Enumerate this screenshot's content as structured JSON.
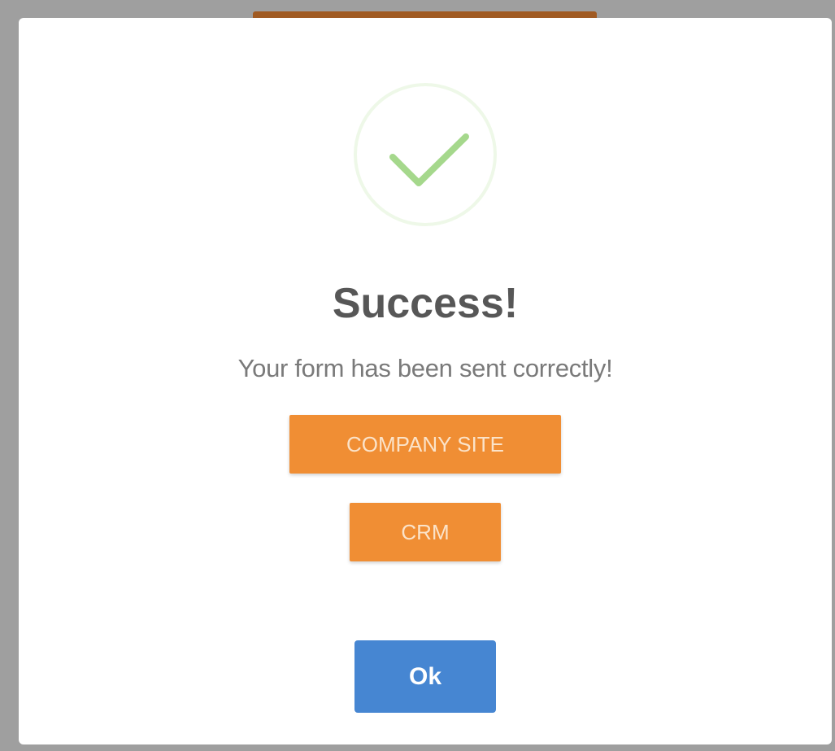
{
  "dialog": {
    "title": "Success!",
    "message": "Your form has been sent correctly!",
    "icon": "checkmark-icon",
    "buttons": {
      "company_site_label": "COMPANY SITE",
      "crm_label": "CRM",
      "ok_label": "Ok"
    }
  },
  "colors": {
    "backdrop": "#9f9f9f",
    "accent_orange": "#f08e34",
    "ok_blue": "#4686d2",
    "success_green": "#a5d88c",
    "title_text": "#575757"
  }
}
